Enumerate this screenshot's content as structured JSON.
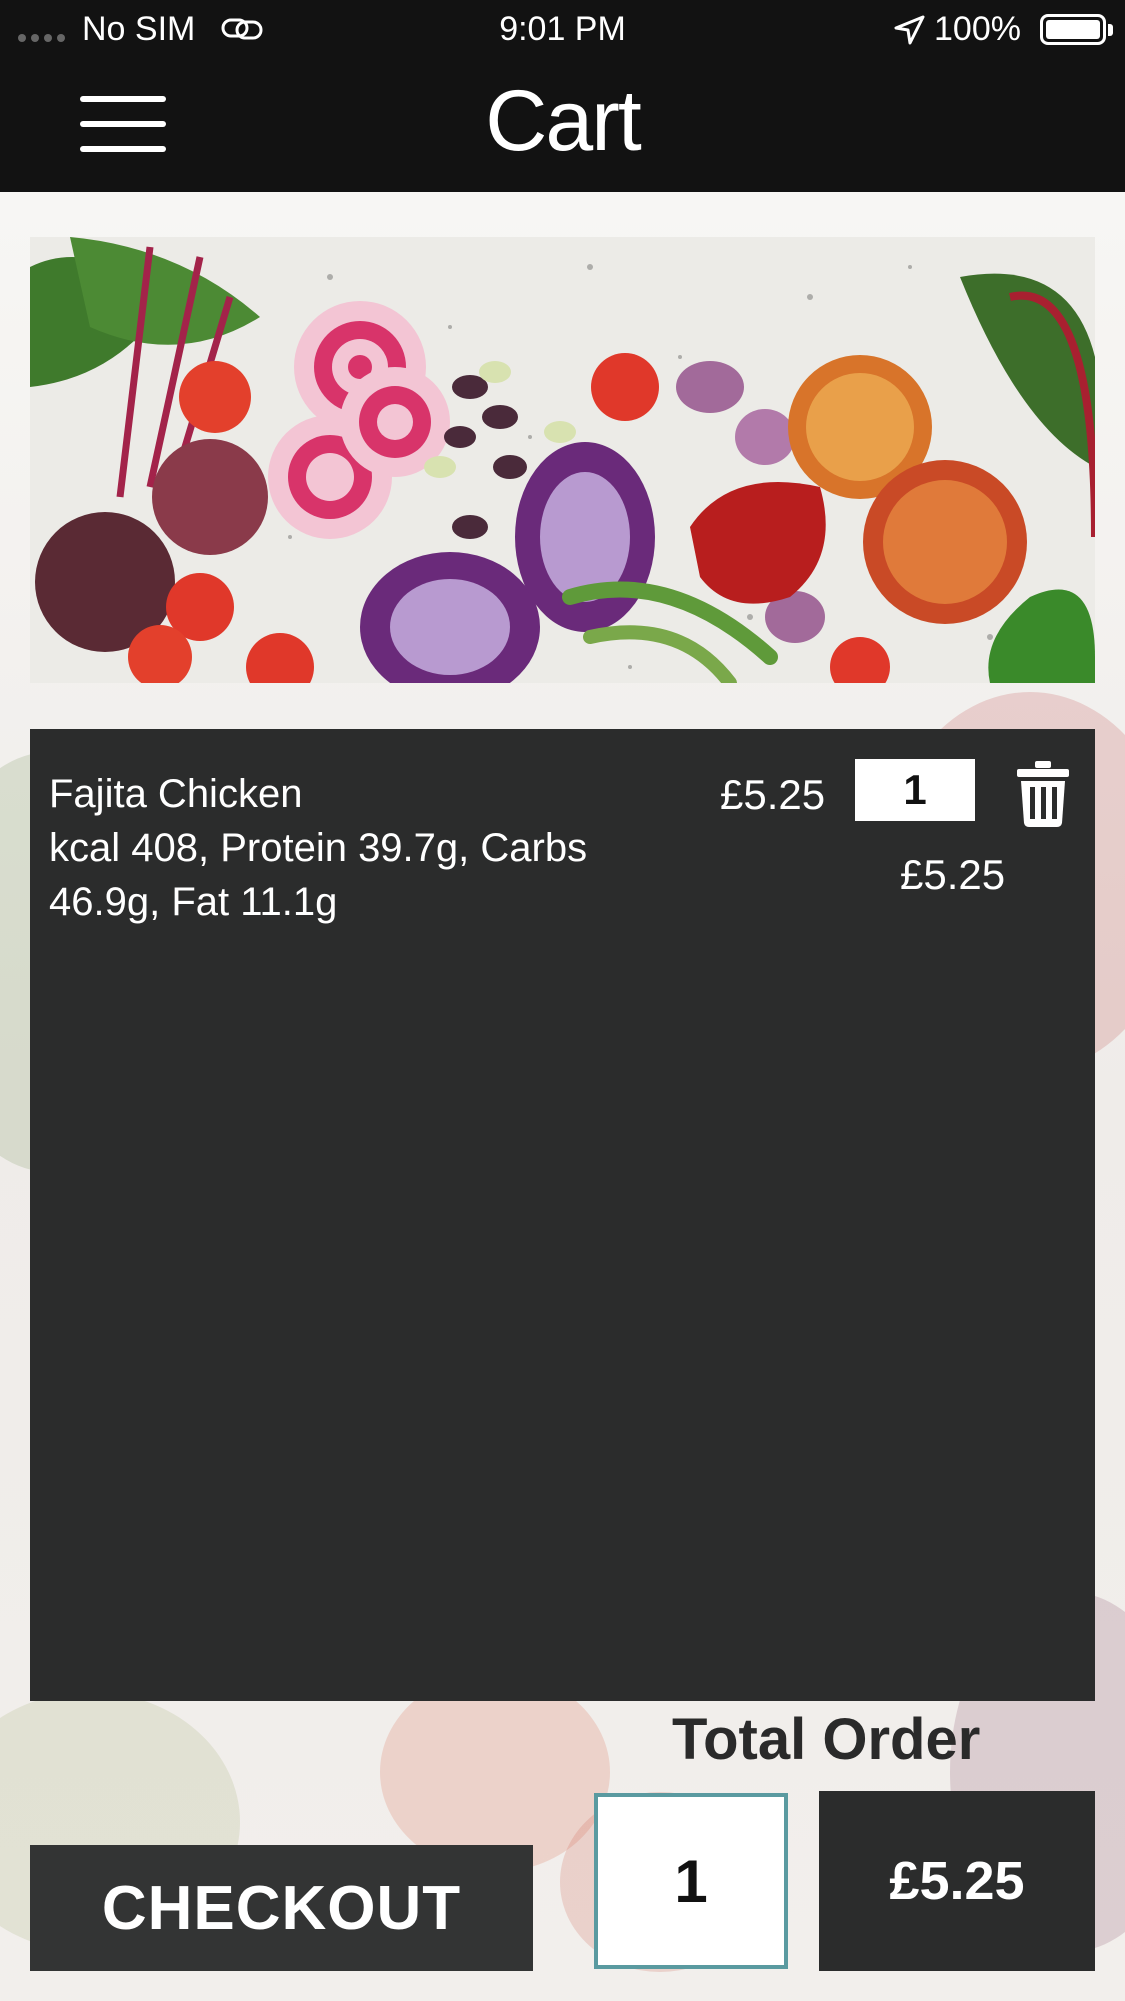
{
  "status_bar": {
    "carrier": "No SIM",
    "time": "9:01 PM",
    "battery": "100%"
  },
  "header": {
    "title": "Cart",
    "menu_icon": "hamburger-menu-icon"
  },
  "cart": {
    "items": [
      {
        "name": "Fajita Chicken",
        "nutrition": "kcal 408, Protein 39.7g, Carbs 46.9g, Fat 11.1g",
        "unit_price": "£5.25",
        "quantity": "1",
        "line_total": "£5.25",
        "delete_icon": "trash-icon"
      }
    ]
  },
  "summary": {
    "total_label": "Total Order",
    "total_quantity": "1",
    "total_price": "£5.25",
    "checkout_label": "CHECKOUT"
  },
  "colors": {
    "bar_background": "#121212",
    "panel_background": "#2b2c2c",
    "quantity_border": "#5a9aa0"
  }
}
